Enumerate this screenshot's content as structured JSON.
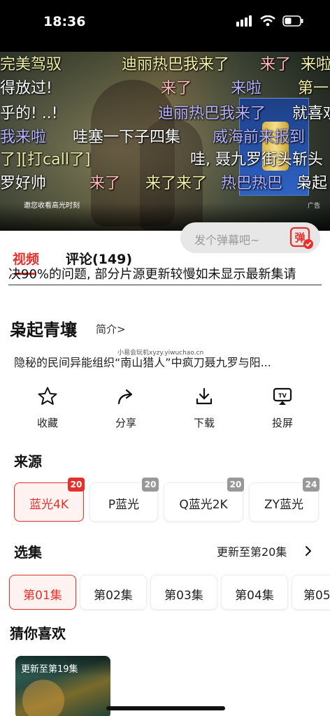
{
  "status_bar": {
    "time": "18:36"
  },
  "video": {
    "promo_text": "邀您收看高光时刻",
    "ad_tag": "广告",
    "danmaku": [
      {
        "text": "完美驾驭",
        "color": "#f0eea6"
      },
      {
        "text": "迪丽热巴我来了",
        "color": "#f0eea6"
      },
      {
        "text": "来了",
        "color": "#ffb7b7"
      },
      {
        "text": "来啦",
        "color": "#f0eea6"
      },
      {
        "text": "得放过!",
        "color": "#ffffff"
      },
      {
        "text": "来了",
        "color": "#ffb7b7"
      },
      {
        "text": "来啦",
        "color": "#b4b2ff"
      },
      {
        "text": "第一",
        "color": "#f0eea6"
      },
      {
        "text": "乎的! ..!",
        "color": "#ffffff"
      },
      {
        "text": "迪丽热巴我来了",
        "color": "#b4b2ff"
      },
      {
        "text": "就喜欢",
        "color": "#ffffff"
      },
      {
        "text": "我来啦",
        "color": "#b4b2ff"
      },
      {
        "text": "哇塞一下子四集",
        "color": "#ffffff"
      },
      {
        "text": "威海前来报到",
        "color": "#b4b2ff"
      },
      {
        "text": "了][打call了]",
        "color": "#f0eea6"
      },
      {
        "text": "哇, 聂九罗街头斩头",
        "color": "#ffffff"
      },
      {
        "text": "罗好帅",
        "color": "#ffffff"
      },
      {
        "text": "来了",
        "color": "#ffb7b7"
      },
      {
        "text": "来了来了",
        "color": "#f0eea6"
      },
      {
        "text": "热巴热巴",
        "color": "#b4b2ff"
      },
      {
        "text": "枭起",
        "color": "#ffffff"
      }
    ]
  },
  "tabs": {
    "video_label": "视频",
    "comments_label": "评论(149)",
    "danmu_placeholder": "发个弹幕吧~",
    "danmu_button_label": "弹"
  },
  "notice": "决90%的问题, 部分片源更新较慢如未显示最新集请",
  "show": {
    "title": "枭起青壤",
    "intro_label": "简介>",
    "description": "隐秘的民间异能组织“南山猎人”中疯刀聂九罗与阳...",
    "watermark": "小易会玩机xyzy.yiwuchao.cn"
  },
  "actions": [
    {
      "label": "收藏",
      "icon": "star-icon"
    },
    {
      "label": "分享",
      "icon": "share-icon"
    },
    {
      "label": "下载",
      "icon": "download-icon"
    },
    {
      "label": "投屏",
      "icon": "tv-cast-icon"
    }
  ],
  "sources": {
    "title": "来源",
    "items": [
      {
        "label": "蓝光4K",
        "badge": "20",
        "active": true
      },
      {
        "label": "P蓝光",
        "badge": "20",
        "active": false
      },
      {
        "label": "Q蓝光2K",
        "badge": "20",
        "active": false
      },
      {
        "label": "ZY蓝光",
        "badge": "24",
        "active": false
      }
    ]
  },
  "episodes": {
    "title": "选集",
    "update_text": "更新至第20集",
    "items": [
      "第01集",
      "第02集",
      "第03集",
      "第04集",
      "第05集"
    ]
  },
  "recommend": {
    "title": "猜你喜欢",
    "items": [
      {
        "badge": "更新至第19集"
      }
    ]
  },
  "colors": {
    "accent": "#e6302b"
  }
}
